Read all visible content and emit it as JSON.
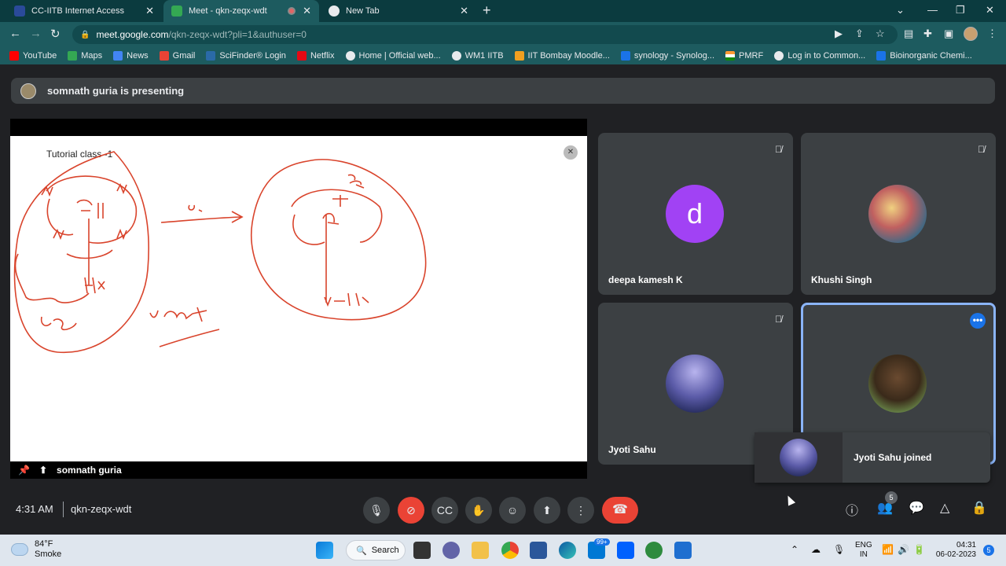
{
  "browser": {
    "tabs": [
      {
        "title": "CC-IITB Internet Access",
        "active": false,
        "color": "#1a73e8"
      },
      {
        "title": "Meet - qkn-zeqx-wdt",
        "active": true,
        "color": "#34a853"
      },
      {
        "title": "New Tab",
        "active": false,
        "color": "#4285f4"
      }
    ],
    "url_host": "meet.google.com",
    "url_rest": "/qkn-zeqx-wdt?pli=1&authuser=0",
    "bookmarks": [
      {
        "label": "YouTube",
        "color": "#ff0000"
      },
      {
        "label": "Maps",
        "color": "#34a853"
      },
      {
        "label": "News",
        "color": "#4285f4"
      },
      {
        "label": "Gmail",
        "color": "#ea4335"
      },
      {
        "label": "SciFinder® Login",
        "color": "#2a6aa8"
      },
      {
        "label": "Netflix",
        "color": "#e50914"
      },
      {
        "label": "Home | Official web...",
        "color": "#5f6368"
      },
      {
        "label": "WM1 IITB",
        "color": "#5f6368"
      },
      {
        "label": "IIT Bombay Moodle...",
        "color": "#f0a020"
      },
      {
        "label": "synology - Synolog...",
        "color": "#1a73e8"
      },
      {
        "label": "PMRF",
        "color": "#ff9933"
      },
      {
        "label": "Log in to Common...",
        "color": "#5f6368"
      },
      {
        "label": "Bioinorganic Chemi...",
        "color": "#1a73e8"
      }
    ]
  },
  "meet": {
    "presenting_text": "somnath guria is presenting",
    "slide_title": "Tutorial class -1",
    "presenter_name": "somnath guria",
    "participants": [
      {
        "name": "deepa kamesh K",
        "avatar": "d",
        "muted": true
      },
      {
        "name": "Khushi Singh",
        "muted": true
      },
      {
        "name": "Jyoti Sahu",
        "muted": true
      },
      {
        "name": "",
        "muted": false,
        "active": true
      }
    ],
    "toast_text": "Jyoti Sahu joined",
    "time": "4:31 AM",
    "meeting_code": "qkn-zeqx-wdt",
    "people_count": "5"
  },
  "taskbar": {
    "temperature": "84°F",
    "weather": "Smoke",
    "search_label": "Search",
    "lang_line1": "ENG",
    "lang_line2": "IN",
    "clock_time": "04:31",
    "clock_date": "06-02-2023",
    "notification_count": "5",
    "mail_badge": "99+"
  }
}
